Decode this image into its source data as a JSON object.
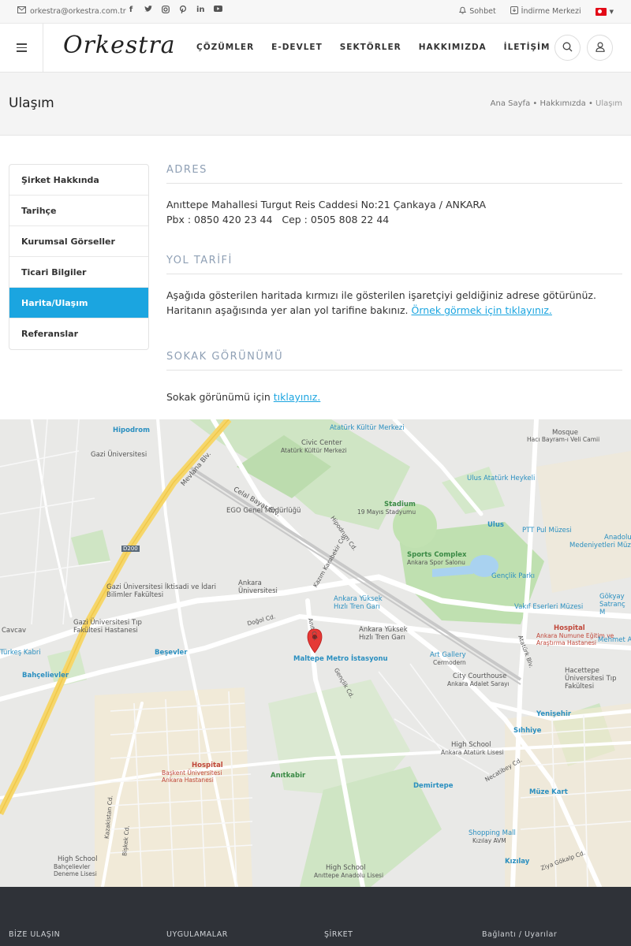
{
  "topbar": {
    "email": "orkestra@orkestra.com.tr",
    "socials": [
      "facebook-icon",
      "twitter-icon",
      "instagram-icon",
      "pinterest-icon",
      "linkedin-icon",
      "youtube-icon"
    ],
    "chat_label": "Sohbet",
    "download_label": "İndirme Merkezi"
  },
  "header": {
    "logo": "Orkestra",
    "nav": [
      "ÇÖZÜMLER",
      "E-DEVLET",
      "SEKTÖRLER",
      "HAKKIMIZDA",
      "İLETİŞİM"
    ]
  },
  "page": {
    "title": "Ulaşım",
    "breadcrumb": {
      "home": "Ana Sayfa",
      "sep": "•",
      "parent": "Hakkımızda",
      "current": "Ulaşım"
    }
  },
  "sidebar": {
    "items": [
      {
        "label": "Şirket Hakkında"
      },
      {
        "label": "Tarihçe"
      },
      {
        "label": "Kurumsal Görseller"
      },
      {
        "label": "Ticari Bilgiler"
      },
      {
        "label": "Harita/Ulaşım",
        "active": true
      },
      {
        "label": "Referanslar"
      }
    ]
  },
  "content": {
    "address_title": "ADRES",
    "address_line": "Anıttepe Mahallesi Turgut Reis Caddesi No:21 Çankaya / ANKARA",
    "phone_line": "Pbx : 0850 420 23 44   Cep : 0505 808 22 44",
    "directions_title": "YOL TARİFİ",
    "directions_text": "Aşağıda gösterilen haritada kırmızı ile gösterilen işaretçiyi geldiğiniz adrese götürünüz. Haritanın aşağısında yer alan yol tarifine bakınız.",
    "directions_link": "Örnek görmek için tıklayınız.",
    "street_title": "SOKAK GÖRÜNÜMÜ",
    "street_text": "Sokak görünümü için",
    "street_link": "tıklayınız."
  },
  "map": {
    "labels": [
      {
        "text": "Hipodrom",
        "style": "blue"
      },
      {
        "text": "Atatürk Kültür Merkezi",
        "style": "blue"
      },
      {
        "text": "Civic Center",
        "style": ""
      },
      {
        "text": "Atatürk Kültür Merkezi",
        "style": ""
      },
      {
        "text": "Mosque",
        "style": ""
      },
      {
        "text": "Hacı Bayram-ı Veli Camii",
        "style": ""
      },
      {
        "text": "Gazi Üniversitesi",
        "style": ""
      },
      {
        "text": "Mevlana Blv.",
        "style": ""
      },
      {
        "text": "Celal Bayar Blv.",
        "style": ""
      },
      {
        "text": "Ulus Atatürk Heykeli",
        "style": "blue"
      },
      {
        "text": "Stadium",
        "style": "green"
      },
      {
        "text": "19 Mayıs Stadyumu",
        "style": ""
      },
      {
        "text": "EGO Genel Müdürlüğü",
        "style": ""
      },
      {
        "text": "Ulus",
        "style": "blue"
      },
      {
        "text": "PTT Pul Müzesi",
        "style": "blue"
      },
      {
        "text": "Medeniyetleri Müzesi",
        "style": "blue"
      },
      {
        "text": "Sports Complex",
        "style": "green"
      },
      {
        "text": "Ankara Spor Salonu",
        "style": ""
      },
      {
        "text": "Gençlik Parkı",
        "style": "blue"
      },
      {
        "text": "Gazi Üniversitesi İktisadi ve İdari Bilimler Fakültesi",
        "style": ""
      },
      {
        "text": "Ankara Üniversitesi",
        "style": ""
      },
      {
        "text": "Ankara Yüksek Hızlı Tren Garı",
        "style": "blue"
      },
      {
        "text": "Vakıf Eserleri Müzesi",
        "style": "blue"
      },
      {
        "text": "Gazi Üniversitesi Tıp Fakültesi Hastanesi",
        "style": ""
      },
      {
        "text": "Ankara Yüksek Hızlı Tren Garı",
        "style": ""
      },
      {
        "text": "Hospital",
        "style": "red"
      },
      {
        "text": "Ankara Numune Eğitim ve Araştırma Hastanesi",
        "style": "red"
      },
      {
        "text": "Beşevler",
        "style": "blue"
      },
      {
        "text": "Maltepe Metro İstasyonu",
        "style": "blue"
      },
      {
        "text": "Art Gallery",
        "style": "blue"
      },
      {
        "text": "Cermodern",
        "style": ""
      },
      {
        "text": "Bahçelievler",
        "style": "blue"
      },
      {
        "text": "City Courthouse",
        "style": ""
      },
      {
        "text": "Ankara Adalet Sarayı",
        "style": ""
      },
      {
        "text": "Hacettepe Üniversitesi Tıp Fakültesi",
        "style": ""
      },
      {
        "text": "Yenişehir",
        "style": "blue"
      },
      {
        "text": "Sıhhiye",
        "style": "blue"
      },
      {
        "text": "High School",
        "style": ""
      },
      {
        "text": "Ankara Atatürk Lisesi",
        "style": ""
      },
      {
        "text": "Hospital",
        "style": "red"
      },
      {
        "text": "Başkent Üniversitesi Ankara Hastanesi",
        "style": "red"
      },
      {
        "text": "Anıtkabir",
        "style": "green"
      },
      {
        "text": "Demirtepe",
        "style": "blue"
      },
      {
        "text": "Müze Kart",
        "style": "blue"
      },
      {
        "text": "Shopping Mall",
        "style": "blue"
      },
      {
        "text": "Kızılay AVM",
        "style": ""
      },
      {
        "text": "Kızılay",
        "style": "blue"
      },
      {
        "text": "High School",
        "style": ""
      },
      {
        "text": "Bahçelievler Deneme Lisesi",
        "style": ""
      },
      {
        "text": "High School",
        "style": ""
      },
      {
        "text": "Anıttepe Anadolu Lisesi",
        "style": ""
      },
      {
        "text": "Mehmet A",
        "style": "blue"
      },
      {
        "text": "Gökyay Satranç M",
        "style": "blue"
      },
      {
        "text": "Anadolu",
        "style": "blue"
      },
      {
        "text": "Cavcav",
        "style": ""
      },
      {
        "text": "Türkeş Kabri",
        "style": "blue"
      },
      {
        "text": "D200",
        "style": ""
      },
      {
        "text": "Hipodrum Cd.",
        "style": ""
      },
      {
        "text": "Kazım Karabekir Cd.",
        "style": ""
      },
      {
        "text": "Gençlik Cd.",
        "style": ""
      },
      {
        "text": "Anıt Cd.",
        "style": ""
      },
      {
        "text": "Doğol Cd.",
        "style": ""
      },
      {
        "text": "Atatürk Blv.",
        "style": ""
      },
      {
        "text": "Kazakistan Cd.",
        "style": ""
      },
      {
        "text": "Bişkek Cd.",
        "style": ""
      },
      {
        "text": "Necatibey Cd.",
        "style": ""
      },
      {
        "text": "Ziya Gökalp Cd.",
        "style": ""
      }
    ]
  },
  "footer": {
    "columns": [
      "BİZE ULAŞIN",
      "UYGULAMALAR",
      "ŞİRKET",
      "Bağlantı / Uyarılar"
    ]
  }
}
